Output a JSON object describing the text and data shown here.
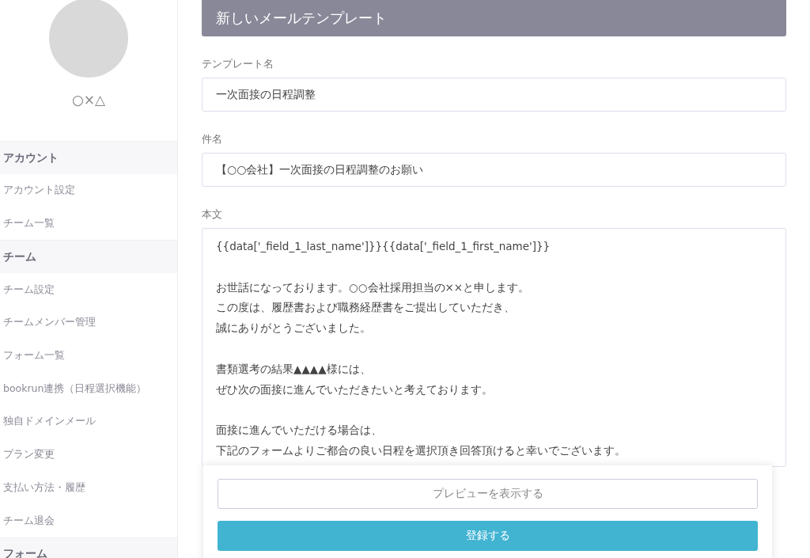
{
  "profile": {
    "name": "○×△"
  },
  "sidebar": {
    "items": [
      {
        "kind": "header",
        "label": "アカウント"
      },
      {
        "kind": "item",
        "label": "アカウント設定"
      },
      {
        "kind": "item",
        "label": "チーム一覧"
      },
      {
        "kind": "header",
        "label": "チーム"
      },
      {
        "kind": "item",
        "label": "チーム設定"
      },
      {
        "kind": "item",
        "label": "チームメンバー管理"
      },
      {
        "kind": "item",
        "label": "フォーム一覧"
      },
      {
        "kind": "item",
        "label": "bookrun連携（日程選択機能）"
      },
      {
        "kind": "item",
        "label": "独自ドメインメール"
      },
      {
        "kind": "item",
        "label": "プラン変更"
      },
      {
        "kind": "item",
        "label": "支払い方法・履歴"
      },
      {
        "kind": "item",
        "label": "チーム退会"
      },
      {
        "kind": "header",
        "label": "フォーム"
      }
    ]
  },
  "panel": {
    "title": "新しいメールテンプレート",
    "fields": [
      {
        "label": "テンプレート名",
        "value": "一次面接の日程調整"
      },
      {
        "label": "件名",
        "value": "【○○会社】一次面接の日程調整のお願い"
      }
    ],
    "body": {
      "label": "本文",
      "paragraphs": [
        [
          "{{data['_field_1_last_name']}}{{data['_field_1_first_name']}}"
        ],
        [
          "お世話になっております。○○会社採用担当の××と申します。",
          "この度は、履歴書および職務経歴書をご提出していただき、",
          "誠にありがとうございました。"
        ],
        [
          "書類選考の結果▲▲▲▲様には、",
          "ぜひ次の面接に進んでいただきたいと考えております。"
        ],
        [
          "面接に進んでいただける場合は、",
          "下記のフォームよりご都合の良い日程を選択頂き回答頂けると幸いでございます。"
        ]
      ]
    }
  },
  "actions": {
    "preview": "プレビューを表示する",
    "submit": "登録する"
  }
}
